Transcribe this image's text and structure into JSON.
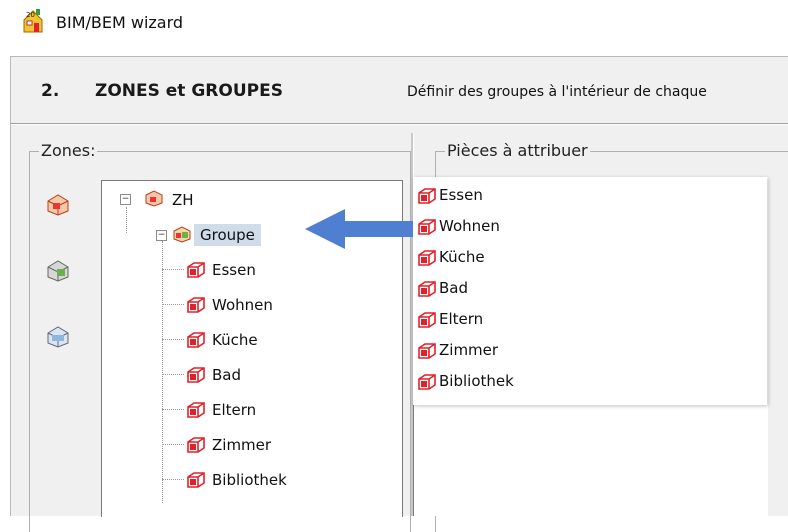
{
  "window": {
    "title": "BIM/BEM wizard"
  },
  "header": {
    "step_number": "2.",
    "step_title": "ZONES et GROUPES",
    "step_description": "Définir des groupes à l'intérieur de chaque"
  },
  "zones_panel": {
    "legend": "Zones:",
    "tree": {
      "zone": "ZH",
      "group": "Groupe",
      "rooms": [
        "Essen",
        "Wohnen",
        "Küche",
        "Bad",
        "Eltern",
        "Zimmer",
        "Bibliothek"
      ]
    }
  },
  "pieces_panel": {
    "legend": "Pièces à attribuer",
    "items": [
      "Essen",
      "Wohnen",
      "Küche",
      "Bad",
      "Eltern",
      "Zimmer",
      "Bibliothek"
    ]
  },
  "colors": {
    "arrow": "#4f7fd1",
    "room_icon": "#e3202a",
    "selection": "#cfdcea"
  },
  "icons": {
    "app": "app-wizard-icon",
    "zone": "zone-icon",
    "group": "group-icon",
    "room": "room-icon",
    "arrow": "drag-arrow-icon"
  }
}
